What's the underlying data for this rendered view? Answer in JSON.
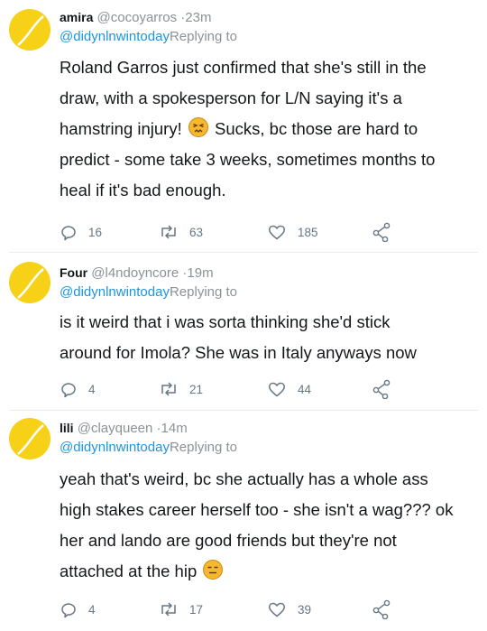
{
  "tweets": [
    {
      "name": "amira",
      "handle": "@cocoyarros",
      "dot": "·",
      "time": "23m",
      "reply_user": "@didynlnwintoday",
      "reply_label": "Replying to",
      "lines": [
        "Roland Garros just confirmed that she's still in the",
        "draw, with a spokesperson for L/N saying it's a",
        "hamstring injury!",
        "Sucks, bc those are hard to",
        "predict - some take 3 weeks, sometimes months to",
        "heal if it's bad enough."
      ],
      "replies": "16",
      "retweets": "63",
      "likes": "185"
    },
    {
      "name": "Four",
      "handle": "@l4ndoyncore",
      "dot": "·",
      "time": "19m",
      "reply_user": "@didynlnwintoday",
      "reply_label": "Replying to",
      "lines": [
        "is it weird that i was sorta thinking she'd stick",
        "around for Imola? She was in Italy anyways now"
      ],
      "replies": "4",
      "retweets": "21",
      "likes": "44"
    },
    {
      "name": "lili",
      "handle": "@clayqueen",
      "dot": "·",
      "time": "14m",
      "reply_user": "@didynlnwintoday",
      "reply_label": "Replying to",
      "lines": [
        "yeah that's weird, bc she actually has a whole ass",
        "high stakes career herself too - she isn't a wag??? ok",
        "her and lando are good friends but they're not",
        "attached at the hip"
      ],
      "replies": "4",
      "retweets": "17",
      "likes": "39"
    }
  ],
  "icons": {
    "reply": "reply-icon",
    "retweet": "retweet-icon",
    "like": "heart-icon",
    "share": "share-icon",
    "emoji_1": "persevering-face-emoji",
    "emoji_2": "expressionless-face-emoji"
  },
  "colors": {
    "avatar": "#f7d117",
    "link": "#1b95e0",
    "muted": "#8b9298",
    "action": "#657786",
    "divider": "#e6ecf0"
  }
}
